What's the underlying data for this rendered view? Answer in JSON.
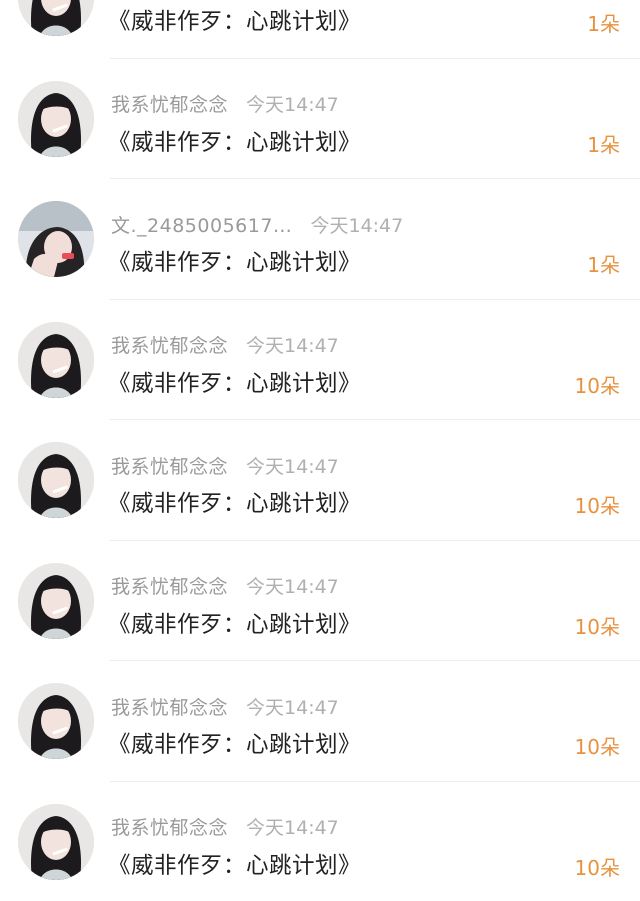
{
  "rows": [
    {
      "username": "",
      "time": "",
      "gift": "《威非作歹：心跳计划》",
      "amount": "1朵",
      "avatar": "girl-b"
    },
    {
      "username": "我系忧郁念念",
      "time": "今天14:47",
      "gift": "《威非作歹：心跳计划》",
      "amount": "1朵",
      "avatar": "girl-b"
    },
    {
      "username": "文._2485005617…",
      "time": "今天14:47",
      "gift": "《威非作歹：心跳计划》",
      "amount": "1朵",
      "avatar": "girl-a"
    },
    {
      "username": "我系忧郁念念",
      "time": "今天14:47",
      "gift": "《威非作歹：心跳计划》",
      "amount": "10朵",
      "avatar": "girl-b"
    },
    {
      "username": "我系忧郁念念",
      "time": "今天14:47",
      "gift": "《威非作歹：心跳计划》",
      "amount": "10朵",
      "avatar": "girl-b"
    },
    {
      "username": "我系忧郁念念",
      "time": "今天14:47",
      "gift": "《威非作歹：心跳计划》",
      "amount": "10朵",
      "avatar": "girl-b"
    },
    {
      "username": "我系忧郁念念",
      "time": "今天14:47",
      "gift": "《威非作歹：心跳计划》",
      "amount": "10朵",
      "avatar": "girl-b"
    },
    {
      "username": "我系忧郁念念",
      "time": "今天14:47",
      "gift": "《威非作歹：心跳计划》",
      "amount": "10朵",
      "avatar": "girl-b"
    }
  ],
  "colors": {
    "amount": "#e8923f",
    "meta": "#9a9a9a",
    "text": "#222222"
  }
}
